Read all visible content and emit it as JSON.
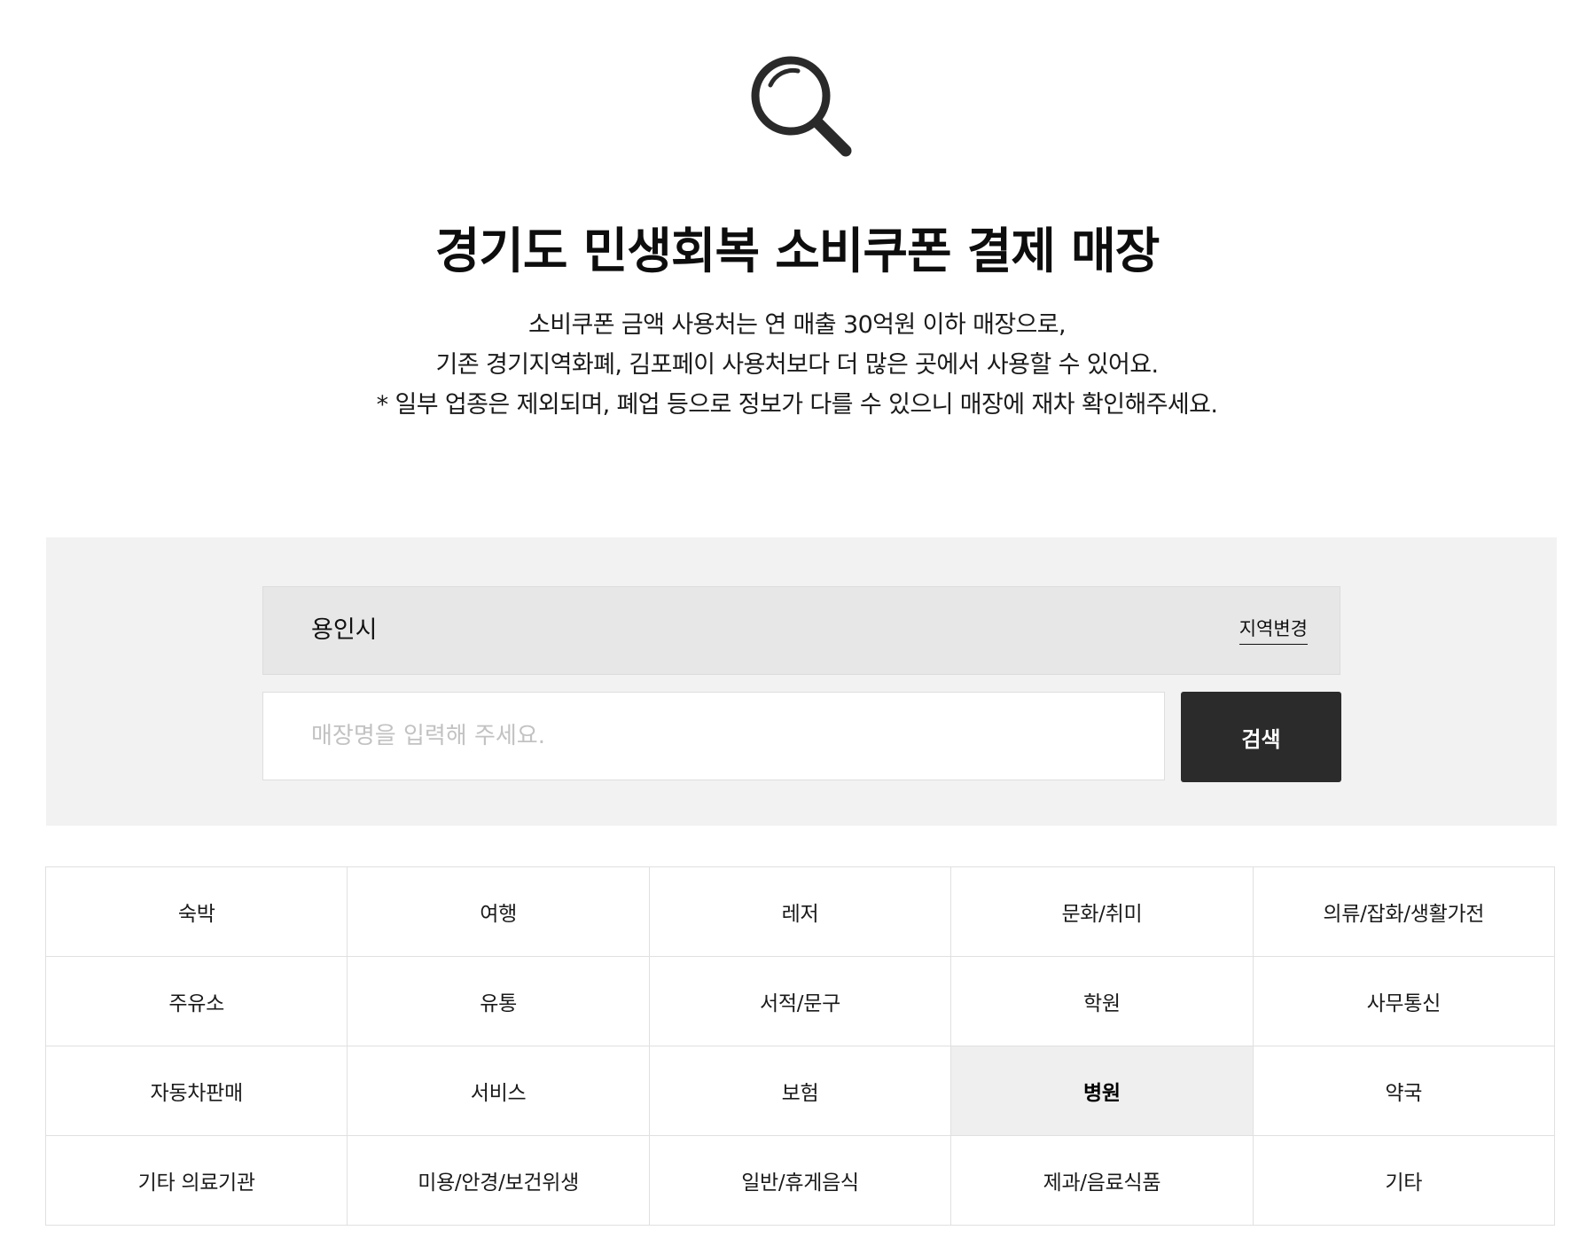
{
  "header": {
    "icon": "magnifier-icon",
    "title": "경기도 민생회복 소비쿠폰 결제 매장",
    "description": [
      "소비쿠폰 금액 사용처는 연 매출 30억원 이하 매장으로,",
      "기존 경기지역화폐, 김포페이 사용처보다 더 많은 곳에서 사용할 수 있어요.",
      "* 일부 업종은 제외되며, 폐업 등으로 정보가 다를 수 있으니 매장에 재차 확인해주세요."
    ]
  },
  "search": {
    "region": "용인시",
    "region_change_label": "지역변경",
    "placeholder": "매장명을 입력해 주세요.",
    "value": "",
    "button_label": "검색"
  },
  "categories": {
    "selected": "병원",
    "items": [
      "숙박",
      "여행",
      "레저",
      "문화/취미",
      "의류/잡화/생활가전",
      "주유소",
      "유통",
      "서적/문구",
      "학원",
      "사무통신",
      "자동차판매",
      "서비스",
      "보험",
      "병원",
      "약국",
      "기타 의료기관",
      "미용/안경/보건위생",
      "일반/휴게음식",
      "제과/음료식품",
      "기타"
    ]
  },
  "colors": {
    "panel_bg": "#f2f2f2",
    "region_bar_bg": "#e7e7e7",
    "button_bg": "#2b2b2b",
    "selected_cell_bg": "#efefef"
  }
}
